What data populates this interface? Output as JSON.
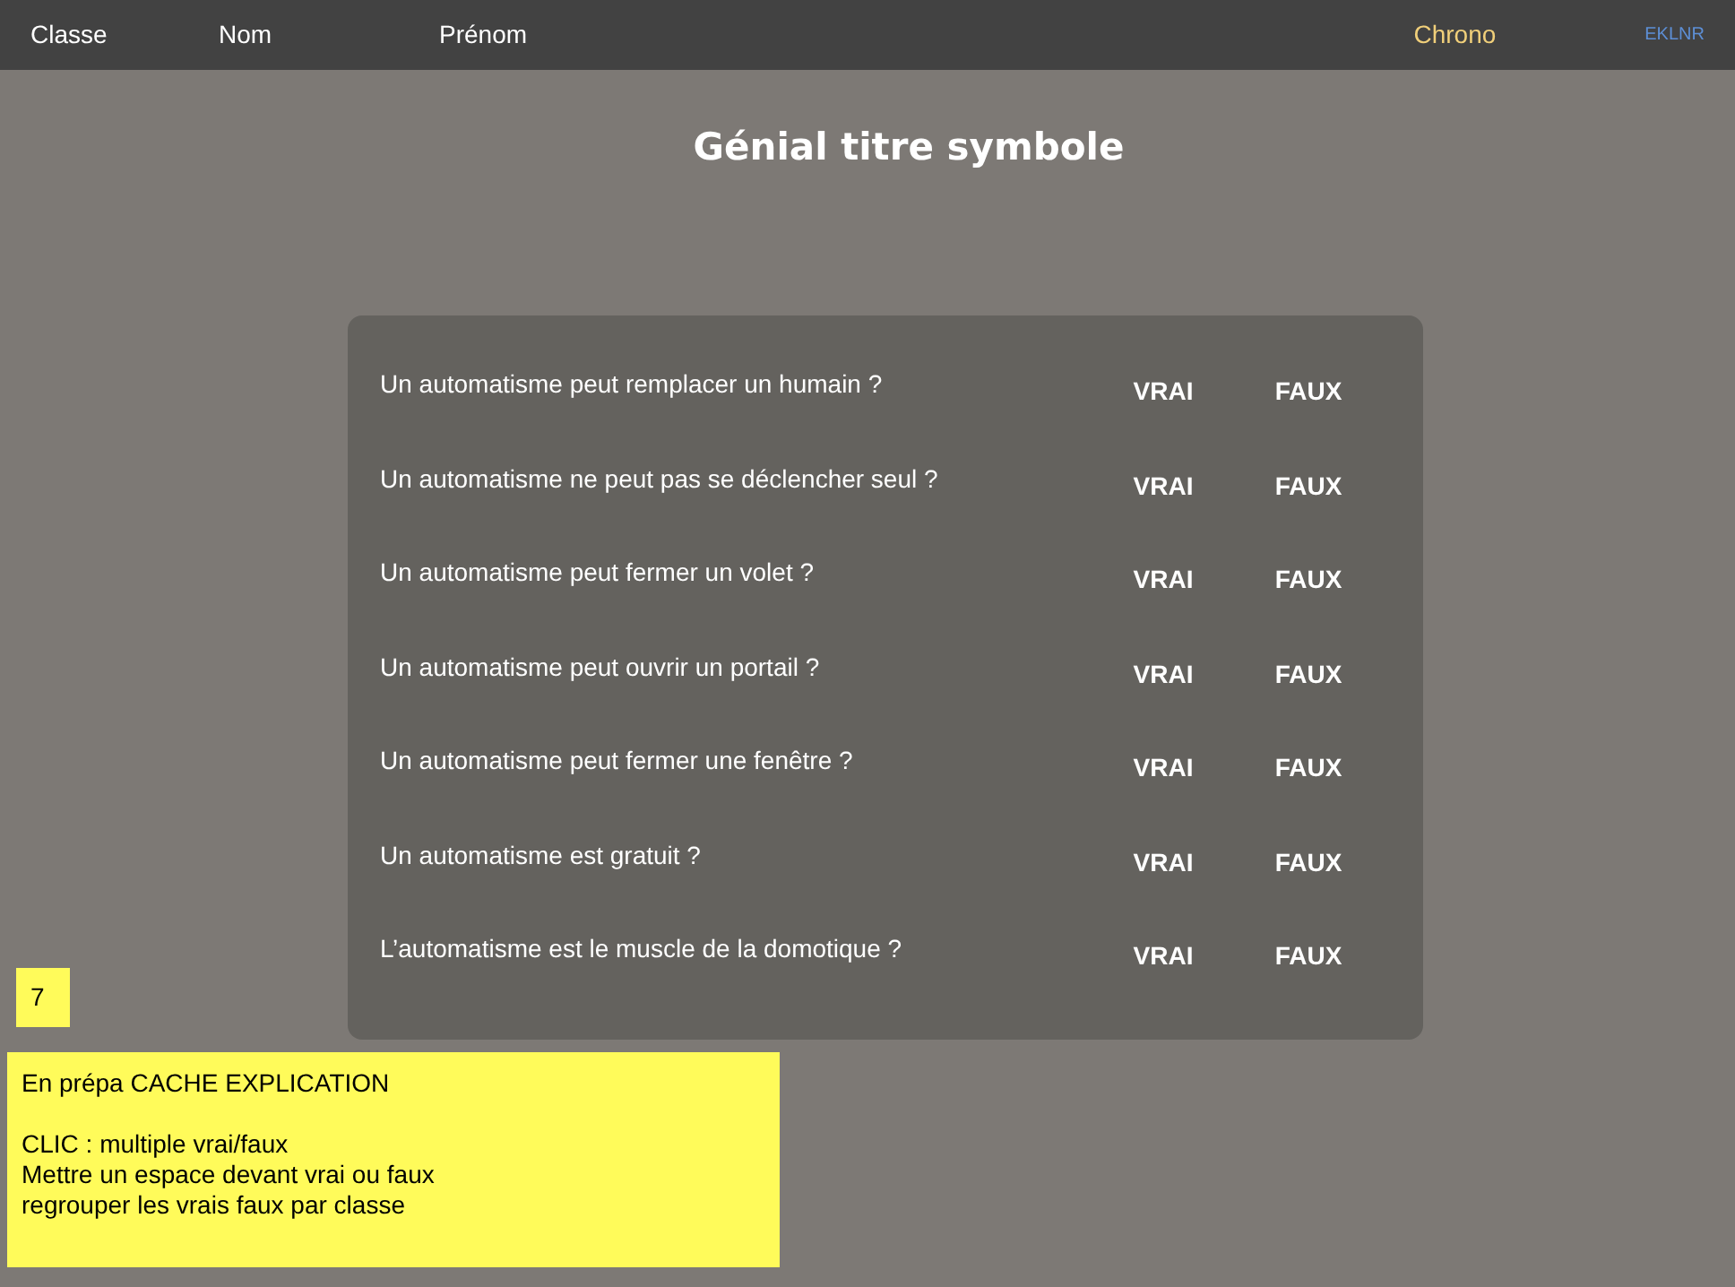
{
  "top_bar": {
    "items": [
      "Classe",
      "Nom",
      "Prénom"
    ],
    "chrono": "Chrono",
    "code": "EKLNR"
  },
  "title": "Génial titre symbole",
  "questions": [
    {
      "text": "Un automatisme peut remplacer un humain ?",
      "true_label": "VRAI",
      "false_label": "FAUX"
    },
    {
      "text": "Un automatisme ne peut pas se déclencher seul ?",
      "true_label": "VRAI",
      "false_label": "FAUX"
    },
    {
      "text": "Un automatisme peut fermer un volet ?",
      "true_label": "VRAI",
      "false_label": "FAUX"
    },
    {
      "text": "Un automatisme peut ouvrir un portail ?",
      "true_label": "VRAI",
      "false_label": "FAUX"
    },
    {
      "text": "Un automatisme peut fermer une fenêtre ?",
      "true_label": "VRAI",
      "false_label": "FAUX"
    },
    {
      "text": "Un automatisme est gratuit ?",
      "true_label": "VRAI",
      "false_label": "FAUX"
    },
    {
      "text": "L’automatisme est le muscle de la domotique ?",
      "true_label": "VRAI",
      "false_label": "FAUX"
    }
  ],
  "page_number": "7",
  "note": {
    "heading": "En prépa CACHE EXPLICATION",
    "lines": [
      "CLIC :  multiple vrai/faux",
      "Mettre un espace devant vrai ou faux",
      "regrouper les vrais faux par classe"
    ]
  }
}
